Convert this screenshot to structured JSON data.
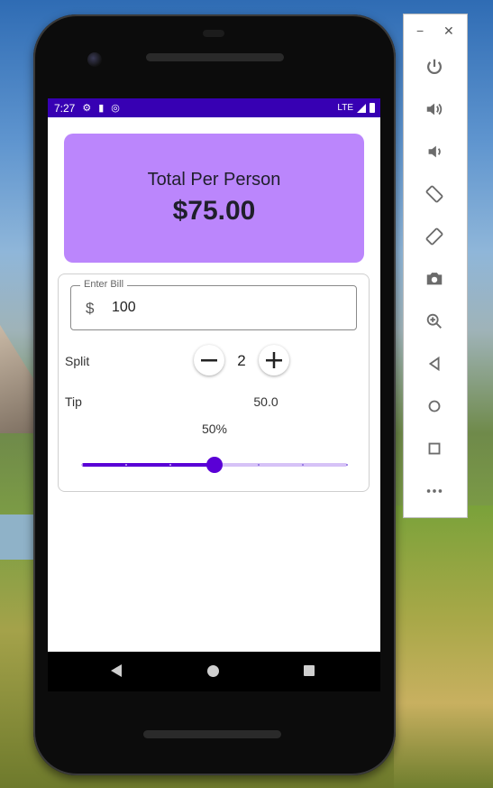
{
  "status_bar": {
    "time": "7:27",
    "network": "LTE"
  },
  "result": {
    "title": "Total Per Person",
    "amount": "$75.00"
  },
  "bill": {
    "label": "Enter Bill",
    "prefix": "$",
    "value": "100"
  },
  "split": {
    "label": "Split",
    "count": "2"
  },
  "tip": {
    "label": "Tip",
    "amount": "50.0",
    "percent_label": "50%",
    "slider_fraction": 0.5,
    "slider_ticks": 7
  },
  "emulator_toolbar": {
    "icons": [
      "power-icon",
      "volume-up-icon",
      "volume-down-icon",
      "rotate-left-icon",
      "rotate-right-icon",
      "camera-icon",
      "zoom-icon",
      "back-icon",
      "home-icon",
      "overview-icon",
      "more-icon"
    ]
  },
  "colors": {
    "status_bar": "#3700b3",
    "result_card": "#bb86fc",
    "slider_active": "#5a00d6",
    "slider_inactive": "#d6c2f7"
  }
}
